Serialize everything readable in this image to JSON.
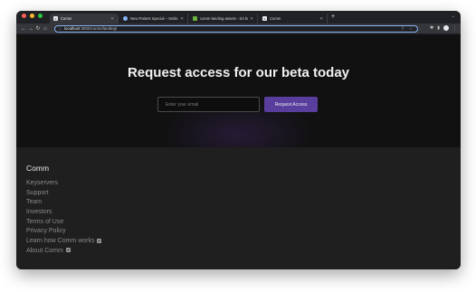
{
  "browser": {
    "tabs": [
      {
        "title": "Comm",
        "favicon": "comm-favicon",
        "active": true
      },
      {
        "title": "New Patient Special – Smile L...",
        "favicon": "blue-globe-favicon",
        "active": false
      },
      {
        "title": "comm-landing-assets - S3 bu...",
        "favicon": "s3-bucket-favicon",
        "active": false
      },
      {
        "title": "Comm",
        "favicon": "comm-favicon",
        "active": false
      }
    ],
    "url_host": "localhost",
    "url_path": ":3000/comm/landing/"
  },
  "hero": {
    "title": "Request access for our beta today",
    "email_placeholder": "Enter your email",
    "button_label": "Request Access"
  },
  "footer": {
    "brand": "Comm",
    "links": [
      {
        "label": "Keyservers",
        "external": false
      },
      {
        "label": "Support",
        "external": false
      },
      {
        "label": "Team",
        "external": false
      },
      {
        "label": "Investors",
        "external": false
      },
      {
        "label": "Terms of Use",
        "external": false
      },
      {
        "label": "Privacy Policy",
        "external": false
      },
      {
        "label": "Learn how Comm works",
        "external": true
      },
      {
        "label": "About Comm",
        "external": true
      }
    ]
  },
  "colors": {
    "page_bg": "#111111",
    "footer_bg": "#1f1f1f",
    "button_accent": "#5a3e9e"
  }
}
